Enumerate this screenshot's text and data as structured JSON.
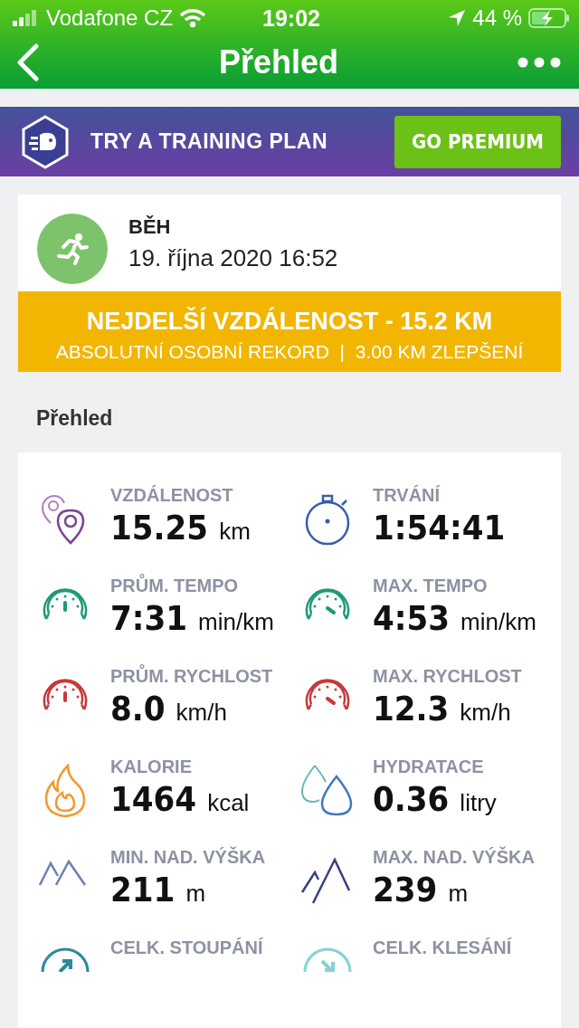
{
  "status_bar": {
    "carrier": "Vodafone CZ",
    "time": "19:02",
    "battery": "44 %"
  },
  "nav": {
    "title": "Přehled"
  },
  "banner": {
    "text": "TRY A TRAINING PLAN",
    "button": "GO PREMIUM"
  },
  "activity": {
    "type": "BĚH",
    "date": "19. října 2020 16:52"
  },
  "record": {
    "title": "NEJDELŠÍ VZDÁLENOST - 15.2 KM",
    "subtitle": "ABSOLUTNÍ OSOBNÍ REKORD  |  3.00 KM ZLEPŠENÍ"
  },
  "section_title": "Přehled",
  "stats": [
    {
      "kind": "distance",
      "label": "VZDÁLENOST",
      "value": "15.25",
      "unit": "km"
    },
    {
      "kind": "duration",
      "label": "TRVÁNÍ",
      "value": "1:54:41"
    },
    {
      "kind": "pace",
      "label": "PRŮM. TEMPO",
      "value": "7:31",
      "unit": "min/km"
    },
    {
      "kind": "max-pace",
      "label": "MAX. TEMPO",
      "value": "4:53",
      "unit": "min/km"
    },
    {
      "kind": "speed",
      "label": "PRŮM. RYCHLOST",
      "value": "8.0",
      "unit": "km/h"
    },
    {
      "kind": "max-speed",
      "label": "MAX. RYCHLOST",
      "value": "12.3",
      "unit": "km/h"
    },
    {
      "kind": "calories",
      "label": "KALORIE",
      "value": "1464",
      "unit": "kcal"
    },
    {
      "kind": "hydration",
      "label": "HYDRATACE",
      "value": "0.36",
      "unit": "litry"
    },
    {
      "kind": "min-elevation",
      "label": "MIN. NAD. VÝŠKA",
      "value": "211",
      "unit": "m"
    },
    {
      "kind": "max-elevation",
      "label": "MAX. NAD. VÝŠKA",
      "value": "239",
      "unit": "m"
    },
    {
      "kind": "ascent",
      "label": "CELK. STOUPÁNÍ"
    },
    {
      "kind": "descent",
      "label": "CELK. KLESÁNÍ"
    }
  ]
}
